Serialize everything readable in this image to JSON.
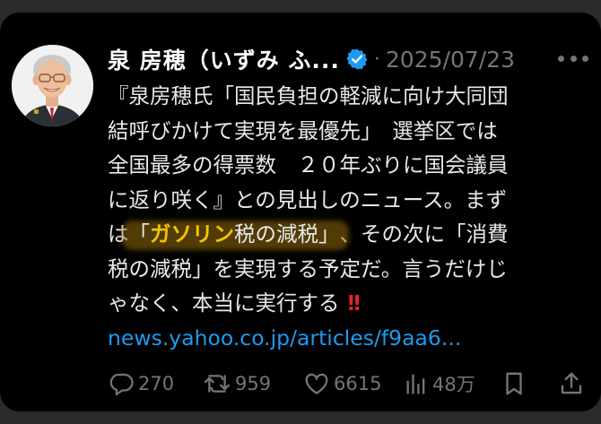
{
  "post": {
    "author_name": "泉 房穂（いずみ ふ...",
    "separator": "·",
    "date": "2025/07/23",
    "body_lines": {
      "l1": "『泉房穂氏「国民負担の軽減に向け大同団",
      "l2": "結呼びかけて実現を最優先」　選挙区では",
      "l3": "全国最多の得票数　２０年ぶりに国会議員",
      "l4": "に返り咲く』との見出しのニュース。まず",
      "l5_prefix": "は",
      "l5_highlight_open": "「",
      "l5_highlight_bold": "ガソリン",
      "l5_highlight_rest": "税の減税」",
      "l5_suffix": "、その次に「消費",
      "l6": "税の減税」を実現する予定だ。言うだけじ",
      "l7": "ゃなく、本当に実行する",
      "l7_emoji": "!!"
    },
    "link_text": "news.yahoo.co.jp/articles/f9aa6..."
  },
  "actions": {
    "replies": "270",
    "reposts": "959",
    "likes": "6615",
    "views": "48万"
  },
  "colors": {
    "accent": "#1d9bf0",
    "highlight_text": "#f5c400",
    "secondary_text": "#71767b",
    "background": "#000000"
  },
  "icons": [
    "verified-badge-icon",
    "more-icon",
    "reply-icon",
    "repost-icon",
    "like-icon",
    "views-icon",
    "bookmark-icon",
    "share-icon"
  ]
}
